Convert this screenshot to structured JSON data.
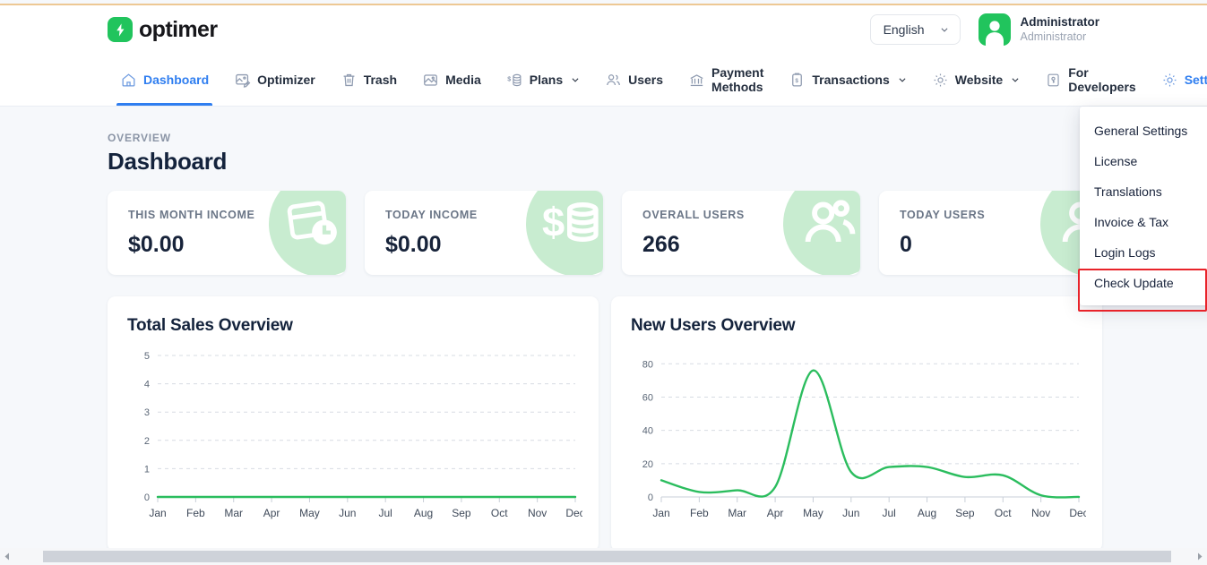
{
  "header": {
    "logo_text": "optimer",
    "logo_icon": "lightning-bolt-icon",
    "language": "English",
    "language_caret": "chevron-down-icon",
    "user_name": "Administrator",
    "user_role": "Administrator",
    "avatar_icon": "user-avatar-icon"
  },
  "nav": {
    "items": [
      {
        "label": "Dashboard",
        "icon": "home-icon",
        "active": true,
        "caret": false
      },
      {
        "label": "Optimizer",
        "icon": "image-edit-icon",
        "active": false,
        "caret": false
      },
      {
        "label": "Trash",
        "icon": "trash-icon",
        "active": false,
        "caret": false
      },
      {
        "label": "Media",
        "icon": "photo-icon",
        "active": false,
        "caret": false
      },
      {
        "label": "Plans",
        "icon": "money-stack-icon",
        "active": false,
        "caret": true
      },
      {
        "label": "Users",
        "icon": "users-icon",
        "active": false,
        "caret": false
      },
      {
        "label_line1": "Payment",
        "label_line2": "Methods",
        "icon": "bank-icon",
        "active": false,
        "caret": false
      },
      {
        "label": "Transactions",
        "icon": "clipboard-icon",
        "active": false,
        "caret": true
      },
      {
        "label": "Website",
        "icon": "gear-icon",
        "active": false,
        "caret": true
      },
      {
        "label_line1": "For",
        "label_line2": "Developers",
        "icon": "key-icon",
        "active": false,
        "caret": false
      },
      {
        "label": "Settings",
        "icon": "gear-icon",
        "active": false,
        "caret": true,
        "open": true
      }
    ]
  },
  "settings_menu": {
    "items": [
      {
        "label": "General Settings",
        "highlighted": false
      },
      {
        "label": "License",
        "highlighted": false
      },
      {
        "label": "Translations",
        "highlighted": false
      },
      {
        "label": "Invoice & Tax",
        "highlighted": false
      },
      {
        "label": "Login Logs",
        "highlighted": false
      },
      {
        "label": "Check Update",
        "highlighted": true
      }
    ],
    "highlight_color": "#e8232a"
  },
  "page": {
    "eyebrow": "OVERVIEW",
    "title": "Dashboard"
  },
  "stats": [
    {
      "label": "THIS MONTH INCOME",
      "value": "$0.00",
      "icon": "calendar-clock-icon"
    },
    {
      "label": "TODAY INCOME",
      "value": "$0.00",
      "icon": "dollar-coins-icon"
    },
    {
      "label": "OVERALL USERS",
      "value": "266",
      "icon": "users-group-icon"
    },
    {
      "label": "TODAY USERS",
      "value": "0",
      "icon": "users-group-icon"
    }
  ],
  "chart_data": [
    {
      "type": "line",
      "title": "Total Sales Overview",
      "categories": [
        "Jan",
        "Feb",
        "Mar",
        "Apr",
        "May",
        "Jun",
        "Jul",
        "Aug",
        "Sep",
        "Oct",
        "Nov",
        "Dec"
      ],
      "values": [
        0,
        0,
        0,
        0,
        0,
        0,
        0,
        0,
        0,
        0,
        0,
        0
      ],
      "series": [
        {
          "name": "Total Sales",
          "values": [
            0,
            0,
            0,
            0,
            0,
            0,
            0,
            0,
            0,
            0,
            0,
            0
          ]
        }
      ],
      "yticks": [
        0,
        1,
        2,
        3,
        4,
        5
      ],
      "ylim": [
        0,
        5
      ],
      "xlabel": "",
      "ylabel": "",
      "grid": true,
      "legend": "none",
      "line_color": "#2bbd5e"
    },
    {
      "type": "line",
      "title": "New Users Overview",
      "categories": [
        "Jan",
        "Feb",
        "Mar",
        "Apr",
        "May",
        "Jun",
        "Jul",
        "Aug",
        "Sep",
        "Oct",
        "Nov",
        "Dec"
      ],
      "values": [
        10,
        3,
        4,
        6,
        76,
        15,
        18,
        18,
        12,
        13,
        1,
        0
      ],
      "series": [
        {
          "name": "New Users",
          "values": [
            10,
            3,
            4,
            6,
            76,
            15,
            18,
            18,
            12,
            13,
            1,
            0
          ]
        }
      ],
      "yticks": [
        0,
        20,
        40,
        60,
        80
      ],
      "ylim": [
        0,
        85
      ],
      "xlabel": "",
      "ylabel": "",
      "grid": true,
      "legend": "none",
      "line_color": "#2bbd5e"
    }
  ],
  "scrollbar": {
    "left_arrow": "triangle-left-icon",
    "right_arrow": "triangle-right-icon"
  }
}
